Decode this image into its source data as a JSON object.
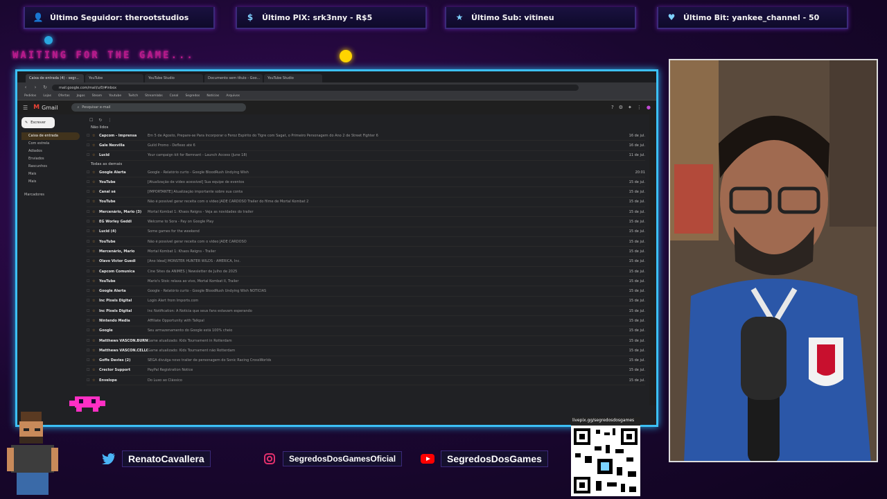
{
  "overlay": {
    "stats": [
      {
        "label": "Último Seguidor: therootstudios",
        "icon": "user-icon"
      },
      {
        "label": "Último PIX: srk3nny - R$5",
        "icon": "dollar-icon"
      },
      {
        "label": "Último Sub: vitineu",
        "icon": "star-icon"
      },
      {
        "label": "Último Bit: yankee_channel - 50",
        "icon": "heart-icon"
      }
    ],
    "waiting_text": "WAITING FOR THE GAME...",
    "socials": [
      {
        "label": "RenatoCavallera",
        "icon": "twitter-icon"
      },
      {
        "label": "SegredosDosGamesOficial",
        "icon": "instagram-icon"
      },
      {
        "label": "SegredosDosGames",
        "icon": "youtube-icon"
      }
    ],
    "qr_url": "livepix.gg/segredosdosgames",
    "accent_colors": {
      "neon_blue": "#3cc0f5",
      "neon_pink": "#ff2fc4",
      "yellow": "#ffd400"
    }
  },
  "browser": {
    "tabs": [
      "Caixa de entrada (4) - segr...",
      "YouTube",
      "YouTube Studio",
      "Documento sem título - Goo...",
      "YouTube Studio"
    ],
    "url": "mail.google.com/mail/u/0/#inbox",
    "bookmarks": [
      "Pedidos",
      "Lojas",
      "Ofertas",
      "Jogos",
      "Steam",
      "Youtube",
      "Twitch",
      "Streamlabs",
      "Canal",
      "Segredos",
      "Notícias",
      "Arquivos"
    ]
  },
  "gmail": {
    "app_name": "Gmail",
    "search_placeholder": "Pesquisar e-mail",
    "compose_label": "Escrever",
    "sidebar": [
      "Caixa de entrada",
      "Com estrela",
      "Adiados",
      "Enviados",
      "Rascunhos",
      "Mais",
      "Mais"
    ],
    "labels_title": "Marcadores",
    "section_unread": "Não lidos",
    "section_all": "Todas as demais",
    "unread": [
      {
        "sender": "Capcom - Imprensa",
        "subject": "Em 5 de Agosto, Prepare-se Para Incorporar o Feroz Espírito do Tigre com Sagat, o Primeiro Personagem do Ano 2 de Street Fighter 6",
        "date": "16 de jul."
      },
      {
        "sender": "Gale Nexvilla",
        "subject": "Guild Promo - Deflexo até 6",
        "date": "16 de jul."
      },
      {
        "sender": "Lucid",
        "subject": "Your campaign kit for Remnant - Launch Access (June 18)",
        "date": "11 de jul."
      }
    ],
    "messages": [
      {
        "sender": "Google Alerta",
        "subject": "Google - Relatório curto - Google BloodRush Undying Wish",
        "date": "20:01"
      },
      {
        "sender": "YouTube",
        "subject": "[Atualização de vídeo acessível] Sua equipe de eventos",
        "date": "15 de jul."
      },
      {
        "sender": "Canal sé",
        "subject": "[IMPORTANTE] Atualização importante sobre sua conta",
        "date": "15 de jul."
      },
      {
        "sender": "YouTube",
        "subject": "Não é possível gerar receita com o vídeo JADE CARDOSO Trailer do filme de Mortal Kombat 2",
        "date": "15 de jul."
      },
      {
        "sender": "Mercenário, Mario (3)",
        "subject": "Mortal Kombat 1: Khaos Reigns - Veja as novidades do trailer",
        "date": "15 de jul."
      },
      {
        "sender": "EG Worley Geddi",
        "subject": "Welcome to Sora - Pay on Google Play",
        "date": "15 de jul."
      },
      {
        "sender": "Lucid (4)",
        "subject": "Some games for the weekend",
        "date": "15 de jul."
      },
      {
        "sender": "YouTube",
        "subject": "Não é possível gerar receita com o vídeo JADE CARDOSO",
        "date": "15 de jul."
      },
      {
        "sender": "Mercenário, Mario",
        "subject": "Mortal Kombat 1: Khaos Reigns - Trailer",
        "date": "15 de jul."
      },
      {
        "sender": "Olavo Victor Guedi",
        "subject": "[Ano Ideal] MONSTER HUNTER WILDS - AMERICA, Inc.",
        "date": "15 de jul."
      },
      {
        "sender": "Capcom Comunica",
        "subject": "Cine Sites da ANIMES | Newsletter de Julho de 2025",
        "date": "15 de jul."
      },
      {
        "sender": "YouTube",
        "subject": "Mario's Stoic relaxa ao vivo, Mortal Kombat II, Trailer",
        "date": "15 de jul."
      },
      {
        "sender": "Google Alerta",
        "subject": "Google - Relatório curto - Google BloodRush Undying Wish NOTÍCIAS",
        "date": "15 de jul."
      },
      {
        "sender": "Inc Pixels Digital",
        "subject": "Login Alert from Imports.com",
        "date": "15 de jul."
      },
      {
        "sender": "Inc Pixels Digital",
        "subject": "Inc Notification: A Notícia que seus fans estavam esperando",
        "date": "15 de jul."
      },
      {
        "sender": "Nintendo Media",
        "subject": "Affiliate Opportunity with Talkpal",
        "date": "15 de jul."
      },
      {
        "sender": "Google",
        "subject": "Seu armazenamento do Google está 100% cheio",
        "date": "15 de jul."
      },
      {
        "sender": "Matthews VASCON.BURN",
        "subject": "Game atualizado: Kids Tournament in Rotterdam",
        "date": "15 de jul."
      },
      {
        "sender": "Matthews VASCON.CELLOS",
        "subject": "Game atualizado: Kids Tournament não Rotterdam",
        "date": "15 de jul."
      },
      {
        "sender": "Goffe Davies (2)",
        "subject": "SEGA divulga novo trailer de personagem do Sonic Racing CrossWorlds",
        "date": "15 de jul."
      },
      {
        "sender": "Crector Support",
        "subject": "PayPal Registration Notice",
        "date": "15 de jul."
      },
      {
        "sender": "Envelope",
        "subject": "Do Luxo ao Clássico",
        "date": "15 de jul."
      }
    ]
  }
}
